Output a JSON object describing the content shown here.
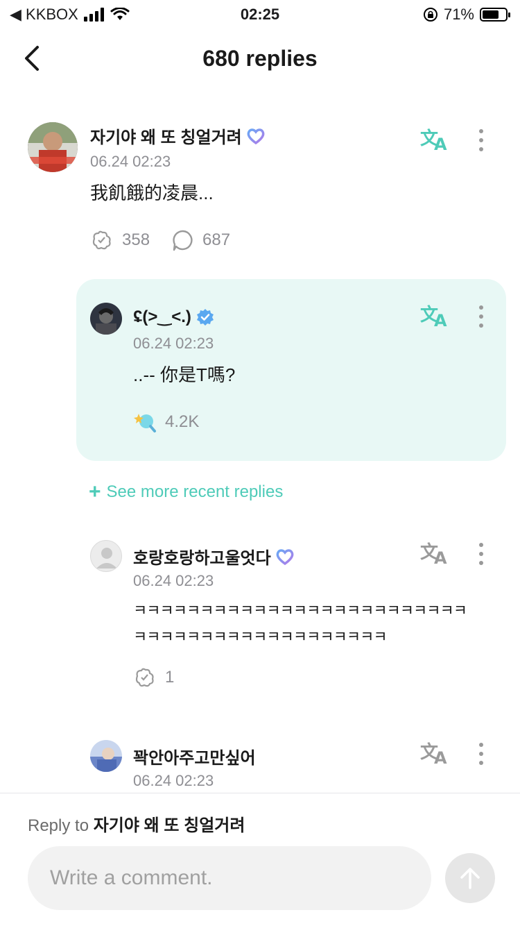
{
  "status_bar": {
    "carrier": "◀ KKBOX",
    "time": "02:25",
    "battery_pct_label": "71%",
    "battery_level": 0.71
  },
  "nav": {
    "title": "680 replies"
  },
  "parent_comment": {
    "username": "자기야 왜 또 칭얼거려",
    "timestamp": "06.24 02:23",
    "content": "我飢餓的凌晨...",
    "like_count": "358",
    "reply_count": "687"
  },
  "highlight_reply": {
    "username": "ʢ(>‿<.)",
    "timestamp": "06.24 02:23",
    "content": "..-- 你是T嗎?",
    "reaction_count": "4.2K"
  },
  "see_more": {
    "plus": "+",
    "label": "See more recent replies"
  },
  "reply_2": {
    "username": "호랑호랑하고울엇다",
    "timestamp": "06.24 02:23",
    "content_line1": "ㅋㅋㅋㅋㅋㅋㅋㅋㅋㅋㅋㅋㅋㅋㅋㅋㅋㅋㅋㅋㅋㅋㅋㅋㅋ",
    "content_line2": "ㅋㅋㅋㅋㅋㅋㅋㅋㅋㅋㅋㅋㅋㅋㅋㅋㅋㅋㅋ",
    "like_count": "1"
  },
  "reply_3": {
    "username": "꽉안아주고만싶어",
    "timestamp": "06.24 02:23"
  },
  "composer": {
    "reply_to_prefix": "Reply to",
    "reply_to_name": "자기야 왜 또 칭얼거려",
    "placeholder": "Write a comment."
  },
  "colors": {
    "accent": "#4ecbb8",
    "highlight_bg": "#e8f8f5",
    "verified_blue": "#5aa8f0"
  }
}
